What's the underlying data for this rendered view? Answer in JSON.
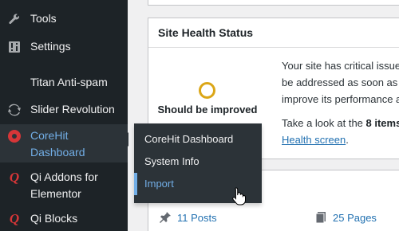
{
  "sidebar": {
    "items": [
      {
        "label": "Tools",
        "icon": "wrench-icon"
      },
      {
        "label": "Settings",
        "icon": "sliders-icon"
      },
      {
        "label": "Titan Anti-spam",
        "icon": ""
      },
      {
        "label": "Slider Revolution",
        "icon": "refresh-icon"
      },
      {
        "label": "CoreHit Dashboard",
        "line1": "CoreHit",
        "line2": "Dashboard",
        "icon": "corehit-icon"
      },
      {
        "label": "Qi Addons for Elementor",
        "line1": "Qi Addons for",
        "line2": "Elementor",
        "icon": "qi-icon"
      },
      {
        "label": "Qi Blocks",
        "icon": "qi-icon"
      }
    ]
  },
  "flyout": {
    "items": [
      {
        "label": "CoreHit Dashboard"
      },
      {
        "label": "System Info"
      },
      {
        "label": "Import",
        "current": true
      }
    ]
  },
  "site_health": {
    "title": "Site Health Status",
    "status_label": "Should be improved",
    "status_color": "#dba617",
    "description_lines": [
      "Your site has critical issues",
      "be addressed as soon as p",
      "improve its performance a"
    ],
    "take_look_prefix": "Take a look at the ",
    "take_look_bold": "8 items",
    "link_text": "Health screen",
    "link_suffix": "."
  },
  "at_a_glance": {
    "posts": "11 Posts",
    "pages": "25 Pages"
  },
  "colors": {
    "sidebar_bg": "#1d2327",
    "submenu_bg": "#2c3338",
    "accent": "#72aee6",
    "link": "#2271b1",
    "warning": "#dba617",
    "brand_red": "#d63638"
  }
}
